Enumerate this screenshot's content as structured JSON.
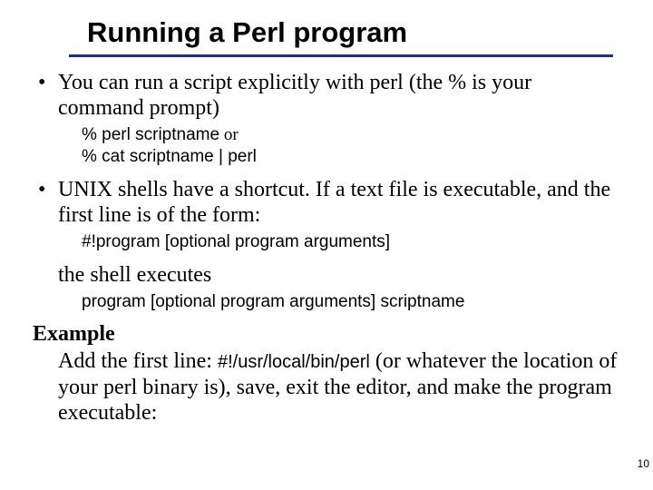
{
  "title": "Running a Perl program",
  "bullet1": "You can run a script explicitly with perl (the % is your command prompt)",
  "code1_line1_cmd": "% perl scriptname",
  "code1_line1_or": " or",
  "code1_line2": "% cat scriptname | perl",
  "bullet2": "UNIX shells have a shortcut. If a text file is executable, and the first line is of the form:",
  "code2": "#!program [optional program arguments]",
  "sub1": "the shell executes",
  "code3": "program [optional program arguments] scriptname",
  "example_heading": "Example",
  "example_prefix": "Add the first line: ",
  "example_code": "#!/usr/local/bin/perl",
  "example_suffix": " (or whatever the location of your perl binary is), save, exit the editor, and make the program executable:",
  "page_number": "10"
}
